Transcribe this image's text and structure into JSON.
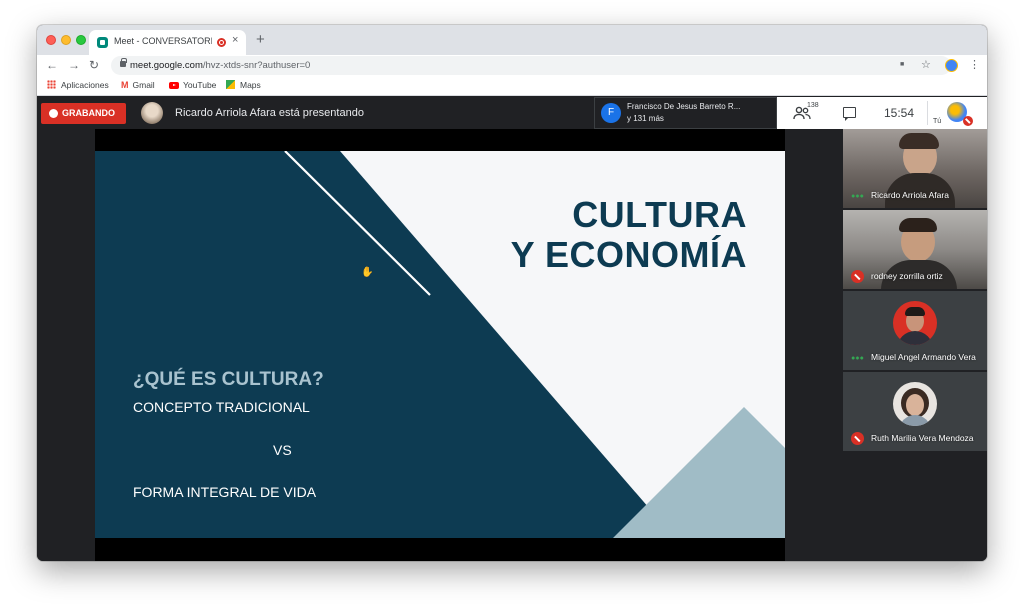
{
  "browser": {
    "tab_title": "Meet - CONVERSATORIOS",
    "tab_close": "×",
    "new_tab": "+",
    "url_host": "meet.google.com",
    "url_path": "/hvz-xtds-snr?authuser=0",
    "nav": {
      "back": "←",
      "forward": "→",
      "reload": "↻"
    },
    "icons": {
      "camera": "■",
      "star": "☆",
      "menu": "⋮"
    },
    "bookmarks": [
      "Aplicaciones",
      "Gmail",
      "YouTube",
      "Maps"
    ]
  },
  "meet": {
    "recording_label": "GRABANDO",
    "presenting_text": "Ricardo Arriola Afara está presentando",
    "notification": {
      "avatar_letter": "F",
      "name": "Francisco De Jesus Barreto R...",
      "more": "y 131 más"
    },
    "people_count": "138",
    "clock": "15:54",
    "self_label": "Tú",
    "slide": {
      "title_line1": "CULTURA",
      "title_line2": "Y ECONOMÍA",
      "question": "¿QUÉ ES CULTURA?",
      "concept": "CONCEPTO TRADICIONAL",
      "vs": "VS",
      "integral": "FORMA INTEGRAL DE VIDA"
    },
    "participants": [
      {
        "name": "Ricardo Arriola Afara",
        "status": "speaking"
      },
      {
        "name": "rodney zorrilla ortiz",
        "status": "muted"
      },
      {
        "name": "Miguel Angel Armando Vera",
        "status": "speaking"
      },
      {
        "name": "Ruth Marilia Vera Mendoza",
        "status": "muted"
      }
    ]
  },
  "colors": {
    "slide_dark": "#0d3b52",
    "slide_light_blue": "#a0bcc6",
    "record_red": "#d93025"
  }
}
